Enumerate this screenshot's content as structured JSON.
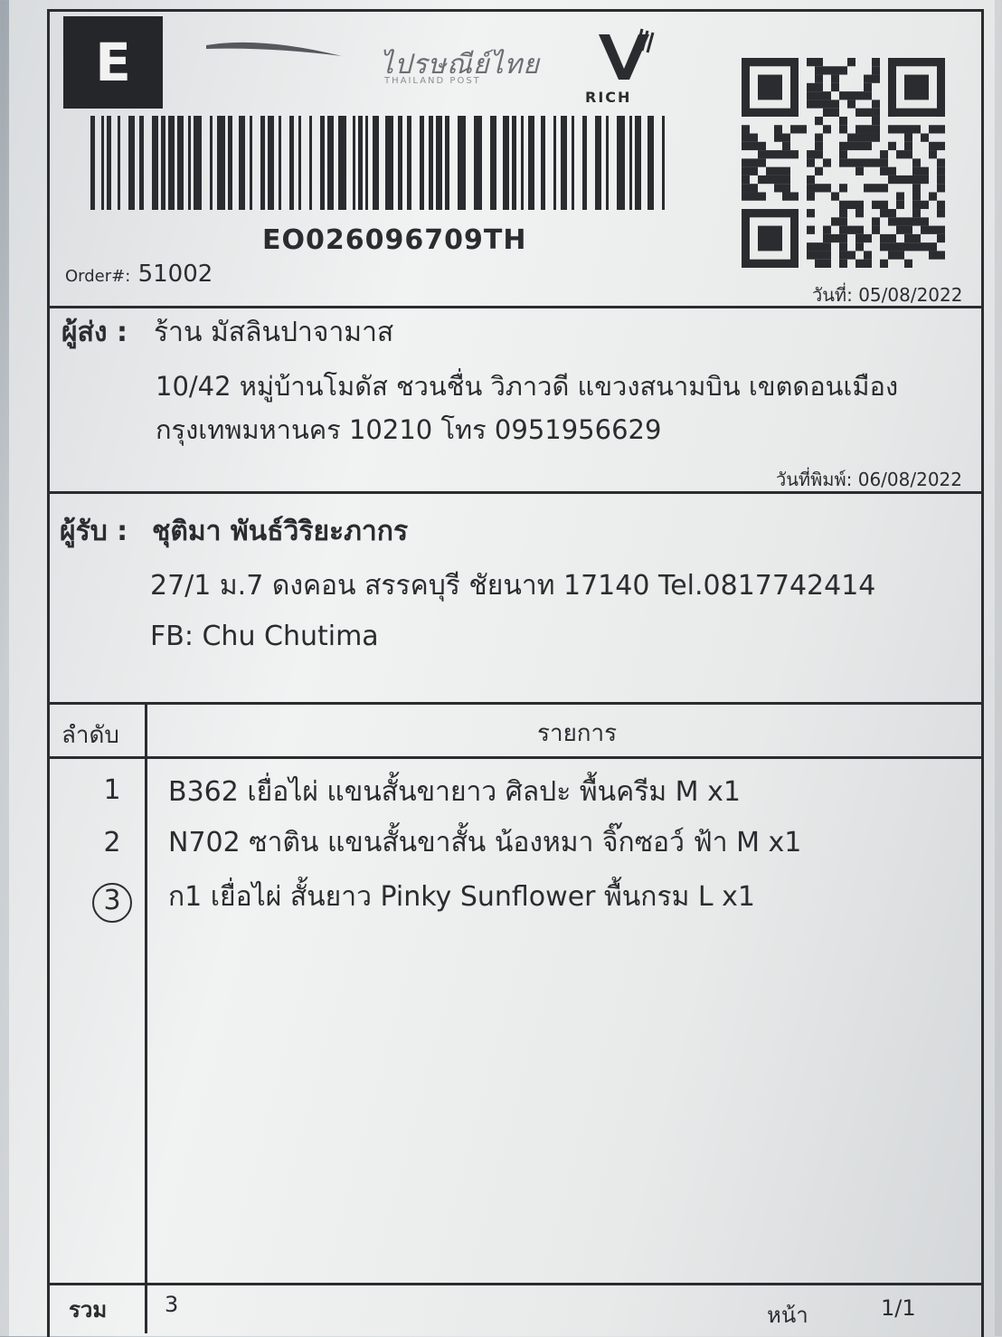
{
  "header": {
    "service_code": "E",
    "thailand_post_script": "ไปรษณีย์ไทย",
    "thailand_post_sub": "THAILAND POST",
    "partner_logo_text": "RICH",
    "tracking_number": "EO026096709TH",
    "order_label": "Order#:",
    "order_number": "51002",
    "date_label": "วันที่:",
    "date": "05/08/2022"
  },
  "sender": {
    "label": "ผู้ส่ง :",
    "name": "ร้าน  มัสลินปาจามาส",
    "address_line1": "10/42 หมู่บ้านโมดัส ชวนชื่น วิภาวดี แขวงสนามบิน เขตดอนเมือง",
    "address_line2": "กรุงเทพมหานคร 10210 โทร 0951956629",
    "print_date_label": "วันที่พิมพ์:",
    "print_date": "06/08/2022"
  },
  "recipient": {
    "label": "ผู้รับ :",
    "name": "ชุติมา พันธ์วิริยะภากร",
    "address_line1": "27/1 ม.7 ดงคอน สรรคบุรี ชัยนาท 17140 Tel.0817742414",
    "address_line2": "FB: Chu Chutima"
  },
  "items_table": {
    "col_index": "ลำดับ",
    "col_items": "รายการ",
    "rows": [
      {
        "index": "1",
        "text": "B362 เยื่อไผ่ แขนสั้นขายาว ศิลปะ พื้นครีม M   x1"
      },
      {
        "index": "2",
        "text": "N702 ซาติน แขนสั้นขาสั้น น้องหมา จิ๊กซอว์ ฟ้า M   x1"
      },
      {
        "index": "3",
        "text": "ก1 เยื่อไผ่ สั้นยาว Pinky Sunflower พื้นกรม L   x1"
      }
    ],
    "total_label": "รวม",
    "total_value": "3",
    "page_label": "หน้า",
    "page_value": "1/1"
  },
  "colors": {
    "ink": "#2a2c2f",
    "paper": "#f1f2f2"
  }
}
